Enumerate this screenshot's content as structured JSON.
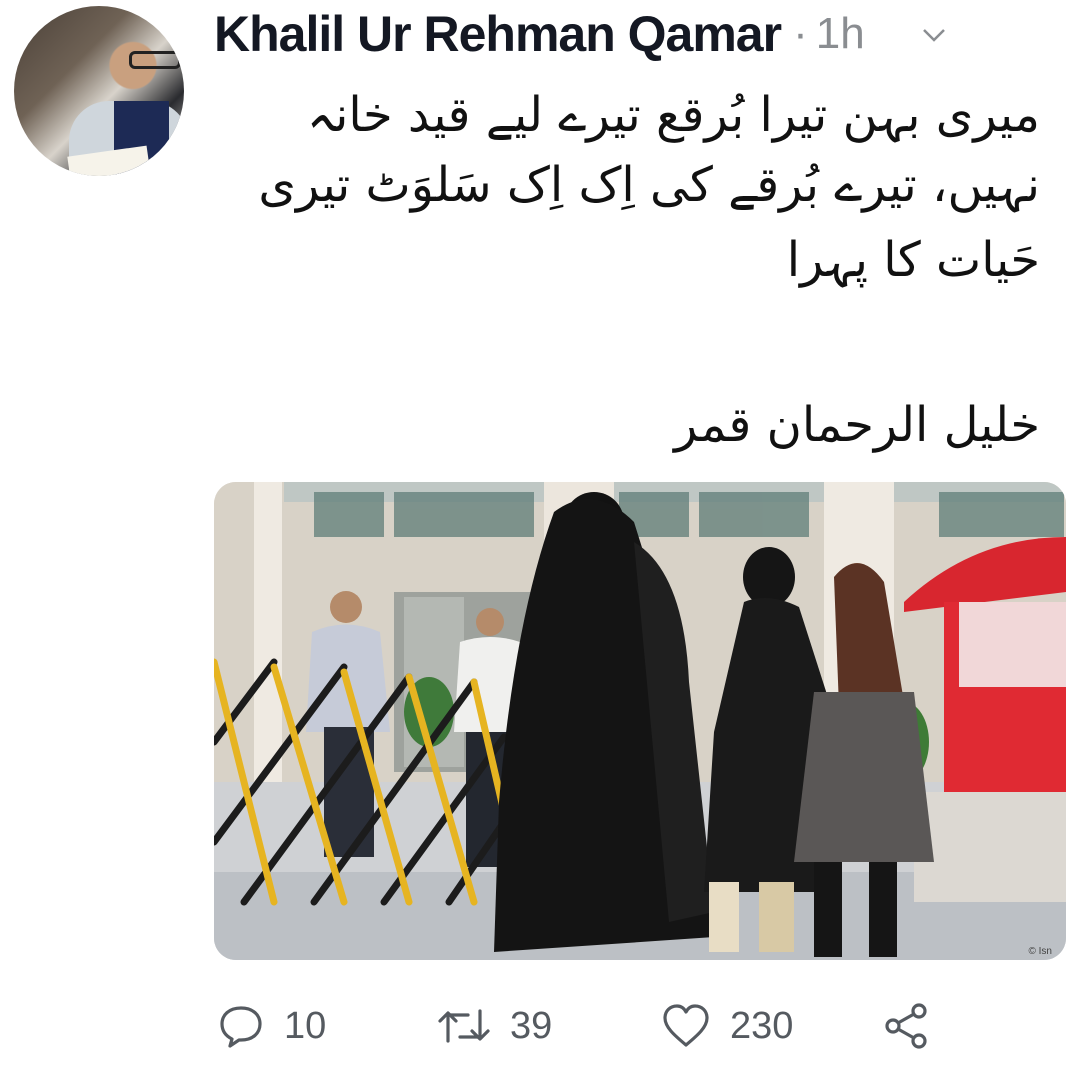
{
  "tweet": {
    "author": "Khalil Ur Rehman Qamar",
    "separator": "·",
    "time": "1h",
    "text_lines": [
      "میری بہن تیرا بُرقع تیرے لیے قید خانہ",
      "نہیں، تیرے بُرقے کی اِک اِک سَلوَٹ تیری",
      "حَیات کا پہرا"
    ],
    "signature": "خلیل الرحمان قمر",
    "image_watermark": "© Isn"
  },
  "actions": {
    "reply_count": "10",
    "retweet_count": "39",
    "like_count": "230"
  },
  "icons": {
    "menu": "chevron-down-icon",
    "reply": "comment-icon",
    "retweet": "retweet-icon",
    "like": "heart-icon",
    "share": "share-icon"
  }
}
